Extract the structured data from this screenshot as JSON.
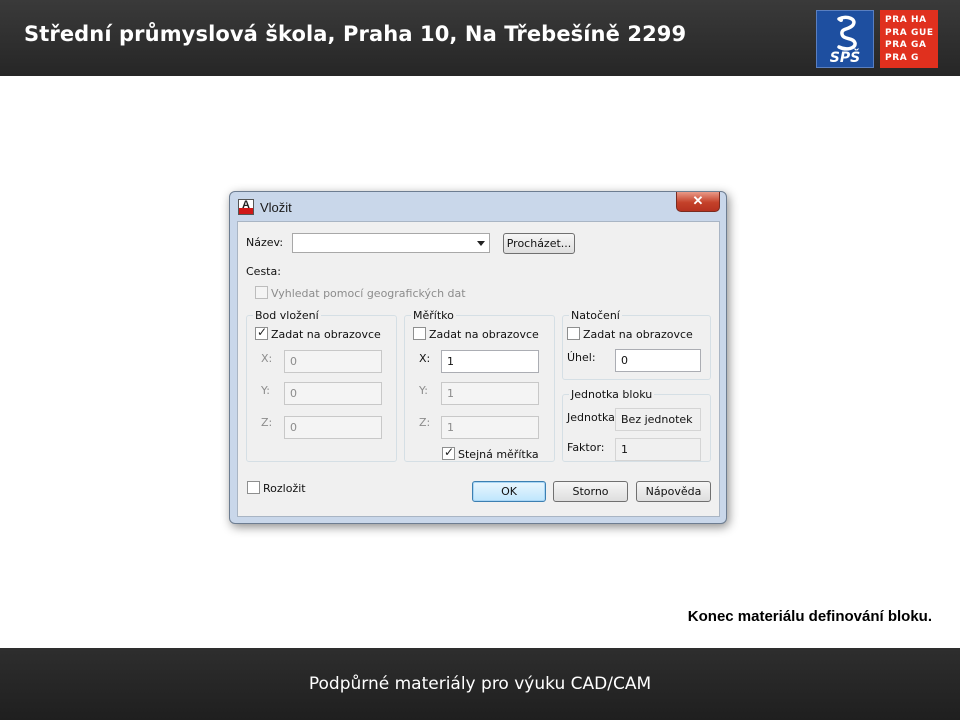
{
  "header": {
    "title": "Střední průmyslová škola, Praha 10, Na Třebešíně 2299",
    "logo_sps_text": "SPŠ",
    "logo_praha_lines": [
      "PRA HA",
      "PRA GUE",
      "PRA GA",
      "PRA G"
    ]
  },
  "dialog": {
    "title": "Vložit",
    "close_label": "✕",
    "name_label": "Název:",
    "name_value": "",
    "browse_button": "Procházet...",
    "path_label": "Cesta:",
    "geo_checkbox_label": "Vyhledat pomocí geografických dat",
    "insertion": {
      "title": "Bod vložení",
      "specify_label": "Zadat na obrazovce",
      "specify_checked": true,
      "x_label": "X:",
      "x_value": "0",
      "y_label": "Y:",
      "y_value": "0",
      "z_label": "Z:",
      "z_value": "0"
    },
    "scale": {
      "title": "Měřítko",
      "specify_label": "Zadat na obrazovce",
      "specify_checked": false,
      "x_label": "X:",
      "x_value": "1",
      "y_label": "Y:",
      "y_value": "1",
      "z_label": "Z:",
      "z_value": "1",
      "uniform_label": "Stejná měřítka",
      "uniform_checked": true
    },
    "rotation": {
      "title": "Natočení",
      "specify_label": "Zadat na obrazovce",
      "specify_checked": false,
      "angle_label": "Úhel:",
      "angle_value": "0"
    },
    "block_unit": {
      "title": "Jednotka bloku",
      "unit_label": "Jednotka:",
      "unit_value": "Bez jednotek",
      "factor_label": "Faktor:",
      "factor_value": "1"
    },
    "explode_label": "Rozložit",
    "explode_checked": false,
    "ok_button": "OK",
    "cancel_button": "Storno",
    "help_button": "Nápověda"
  },
  "caption": "Konec materiálu definování bloku.",
  "footer": {
    "text": "Podpůrné materiály pro výuku CAD/CAM"
  }
}
